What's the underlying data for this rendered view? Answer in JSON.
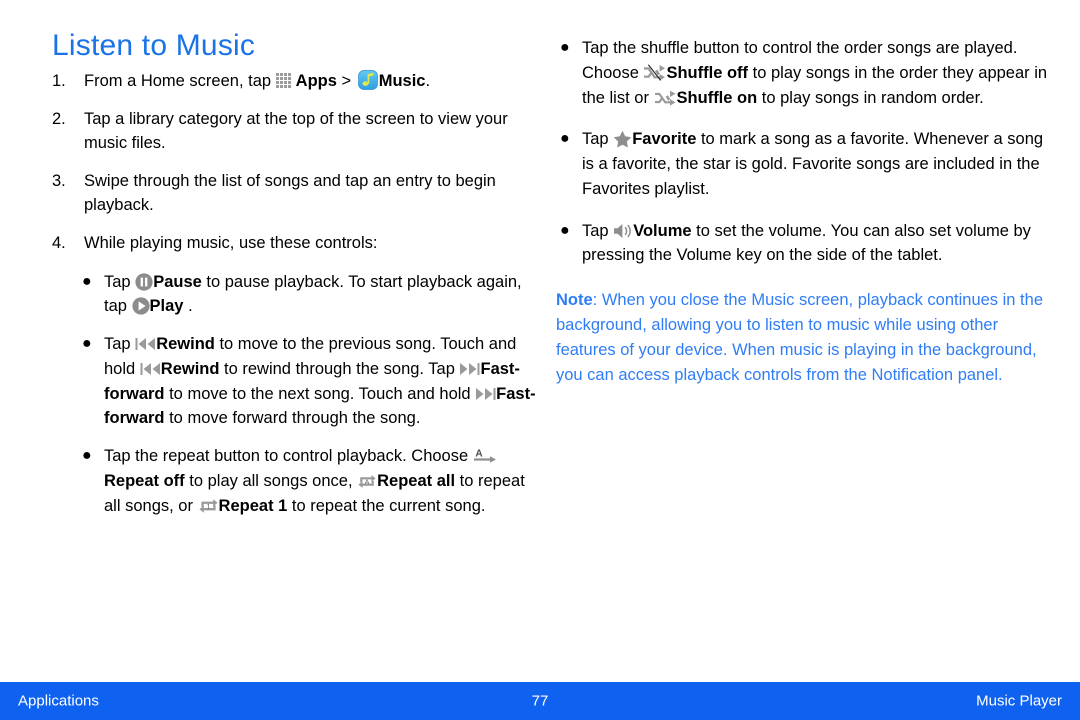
{
  "document": {
    "title": "Listen to Music"
  },
  "steps": [
    {
      "num": "1.",
      "parts": [
        {
          "t": "text",
          "v": "From a Home screen, tap "
        },
        {
          "t": "icon",
          "v": "apps-icon"
        },
        {
          "t": "bold",
          "v": "Apps"
        },
        {
          "t": "text",
          "v": " > "
        },
        {
          "t": "icon",
          "v": "music-icon"
        },
        {
          "t": "bold",
          "v": "Music"
        },
        {
          "t": "text",
          "v": "."
        }
      ]
    },
    {
      "num": "2.",
      "parts": [
        {
          "t": "text",
          "v": "Tap a library category at the top of the screen to view your music files."
        }
      ]
    },
    {
      "num": "3.",
      "parts": [
        {
          "t": "text",
          "v": "Swipe through the list of songs and tap an entry to begin playback."
        }
      ]
    },
    {
      "num": "4.",
      "parts": [
        {
          "t": "text",
          "v": "While playing music, use these controls:"
        }
      ]
    }
  ],
  "left_bullets": [
    {
      "id": "pause-play",
      "text": "Tap Pause to pause playback. To start playback again, tap Play .",
      "bold_terms": [
        "Pause",
        "Play"
      ],
      "icons": [
        "pause-icon",
        "play-icon"
      ]
    },
    {
      "id": "rewind-fastforward",
      "text": "Tap Rewind to move to the previous song. Touch and hold Rewind to rewind through the song. Tap Fast-forward to move to the next song. Touch and hold Fast-forward to move forward through the song.",
      "bold_terms": [
        "Rewind",
        "Rewind",
        "Fast-forward",
        "Fast-forward"
      ],
      "icons": [
        "rewind-icon",
        "rewind-icon",
        "fast-forward-icon",
        "fast-forward-icon"
      ]
    },
    {
      "id": "repeat",
      "text": "Tap the repeat button to control playback. Choose Repeat off to play all songs once, Repeat all to repeat all songs, or Repeat 1 to repeat the current song.",
      "bold_terms": [
        "Repeat off",
        "Repeat all",
        "Repeat 1"
      ],
      "icons": [
        "repeat-off-icon",
        "repeat-all-icon",
        "repeat-1-icon"
      ]
    }
  ],
  "right_bullets": [
    {
      "id": "shuffle",
      "text": "Tap the shuffle button to control the order songs are played. Choose Shuffle off to play songs in the order they appear in the list or Shuffle on to play songs in random order.",
      "bold_terms": [
        "Shuffle off",
        "Shuffle on"
      ],
      "icons": [
        "shuffle-off-icon",
        "shuffle-on-icon"
      ]
    },
    {
      "id": "favorite",
      "text": "Tap Favorite  to mark a song as a favorite. Whenever a song is a favorite, the star is gold. Favorite songs are included in the Favorites playlist.",
      "bold_terms": [
        "Favorite"
      ],
      "icons": [
        "star-icon"
      ]
    },
    {
      "id": "volume",
      "text": "Tap Volume to set the volume. You can also set volume by pressing the Volume key on the side of the tablet.",
      "bold_terms": [
        "Volume"
      ],
      "icons": [
        "volume-icon"
      ]
    }
  ],
  "fragments": {
    "s1_a": "From a Home screen, tap ",
    "s1_apps": "Apps",
    "s1_gt": " > ",
    "s1_music": "Music",
    "s1_end": ".",
    "s2": "Tap a library category at the top of the screen to view your music files.",
    "s3": "Swipe through the list of songs and tap an entry to begin playback.",
    "s4": "While playing music, use these controls:",
    "b1_a": "Tap ",
    "b1_pause": "Pause",
    "b1_b": " to pause playback. To start playback again, tap ",
    "b1_play": "Play",
    "b1_c": " .",
    "b2_a": "Tap ",
    "b2_rewind1": "Rewind",
    "b2_b": " to move to the previous song. Touch and hold ",
    "b2_rewind2": "Rewind",
    "b2_c": " to rewind through the song. Tap ",
    "b2_ff1": "Fast-forward",
    "b2_d": " to move to the next song. Touch and hold ",
    "b2_ff2": "Fast-forward",
    "b2_e": " to move forward through the song.",
    "b3_a": "Tap the repeat button to control playback. Choose ",
    "b3_off": "Repeat off",
    "b3_b": " to play all songs once, ",
    "b3_all": "Repeat all",
    "b3_c": " to repeat all songs, or ",
    "b3_one": "Repeat 1",
    "b3_d": " to repeat the current song.",
    "r1_a": "Tap the shuffle button to control the order songs are played. Choose ",
    "r1_off": "Shuffle off",
    "r1_b": " to play songs in the order they appear in the list or ",
    "r1_on": "Shuffle on",
    "r1_c": " to play songs in random order.",
    "r2_a": "Tap ",
    "r2_fav": "Favorite",
    "r2_b": "  to mark a song as a favorite. Whenever a song is a favorite, the star is gold. Favorite songs are included in the Favorites playlist.",
    "r3_a": "Tap ",
    "r3_vol": "Volume",
    "r3_b": " to set the volume. You can also set volume by pressing the Volume key on the side of the tablet."
  },
  "note": {
    "label": "Note",
    "body": ": When you close the Music screen, playback continues in the background, allowing you to listen to music while using other features of your device. When music is playing in the background, you can access playback controls from the Notification panel."
  },
  "footer": {
    "left": "Applications",
    "page": "77",
    "right": "Music Player"
  },
  "colors": {
    "title_blue": "#1a73e8",
    "note_blue": "#2f7df6",
    "footer_blue": "#0f62f0",
    "icon_gray": "#8a8a8a",
    "music_tile_blue": "#47b4ee",
    "music_note_yellow": "#d7e34a"
  },
  "bullet_glyph": "●"
}
